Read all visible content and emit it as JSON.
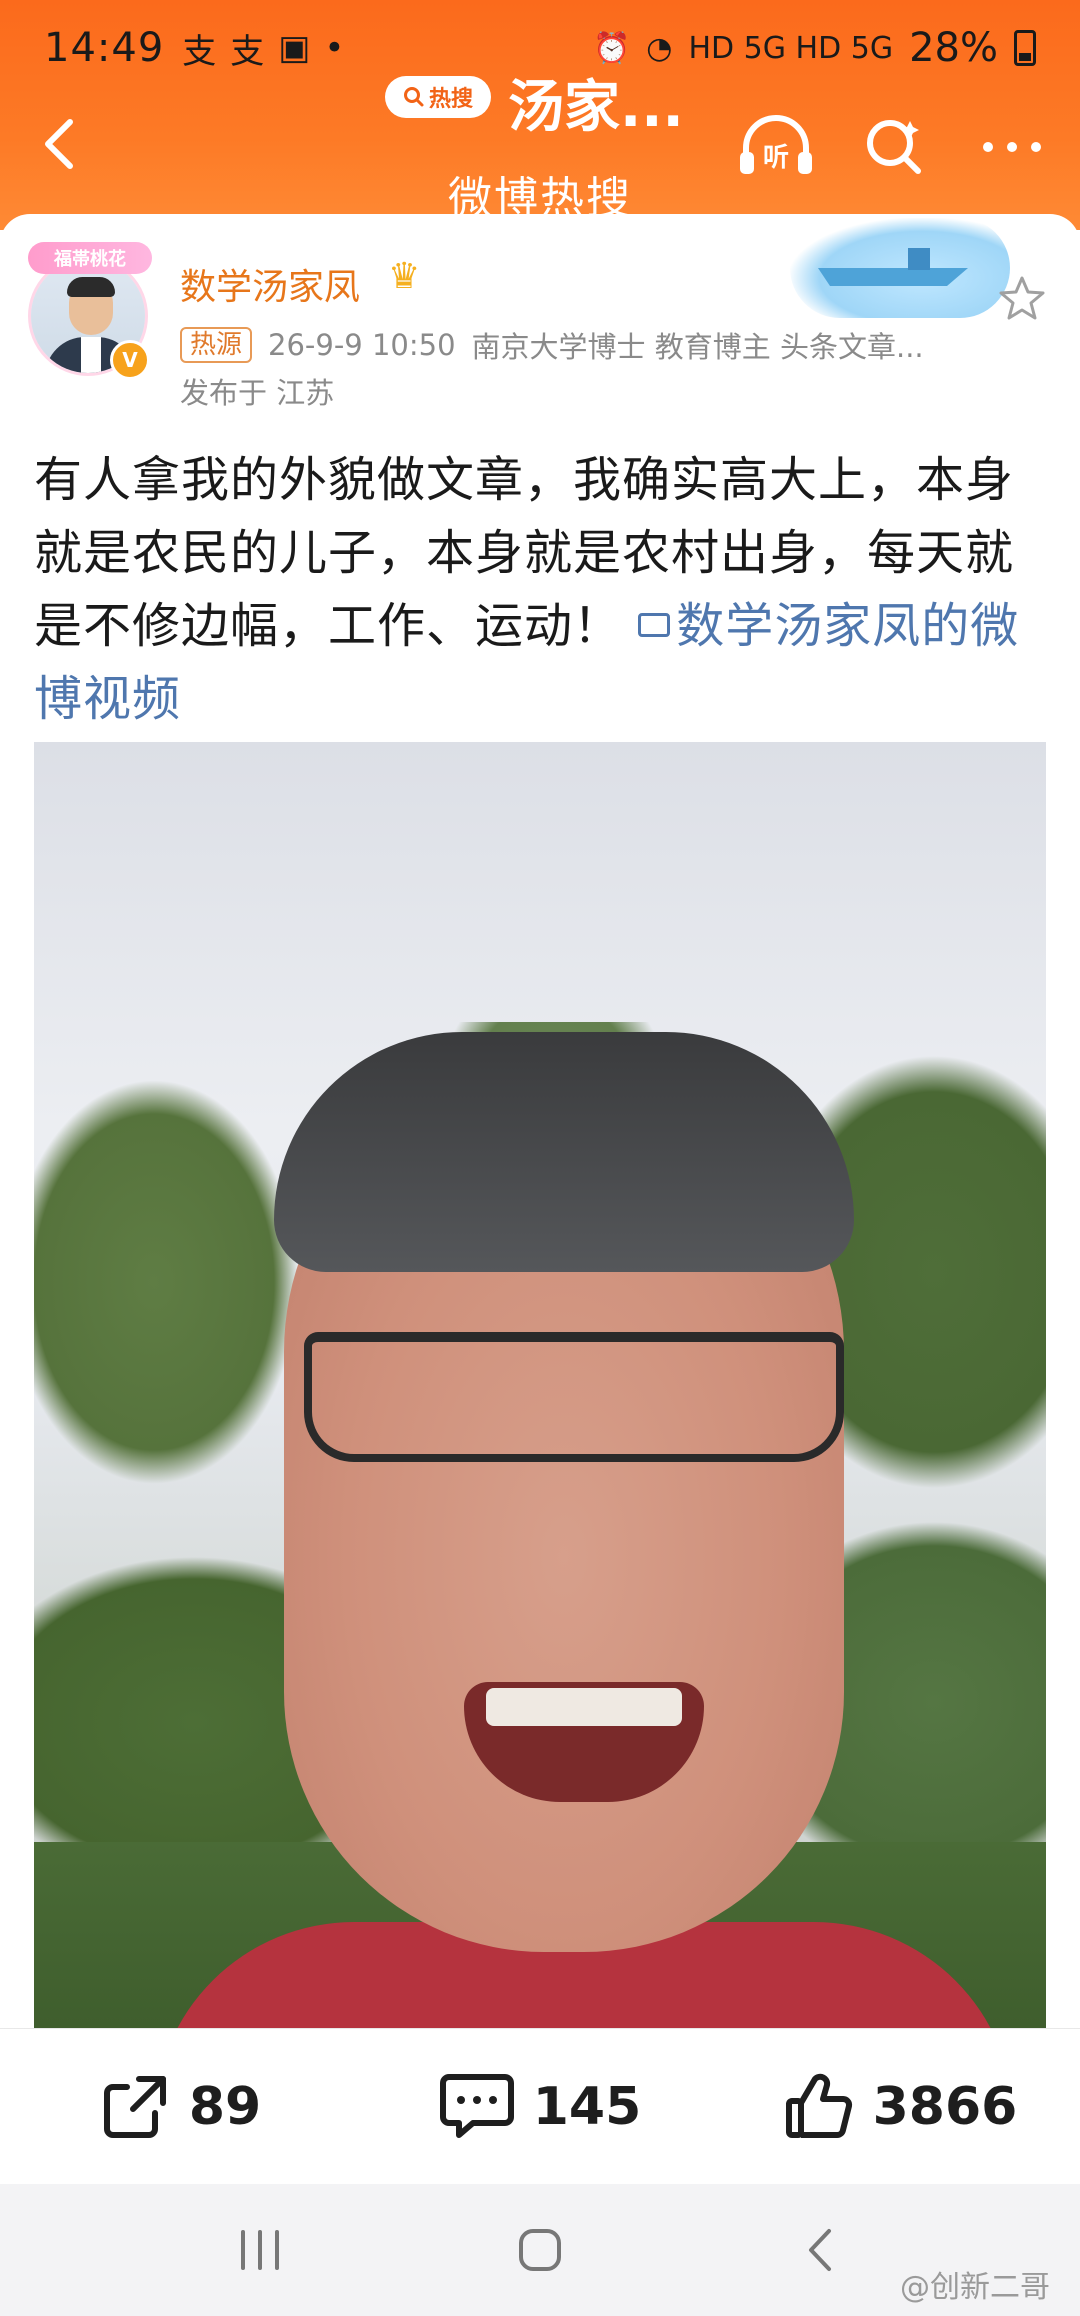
{
  "status_bar": {
    "time": "14:49",
    "left_icons": [
      "alipay-icon",
      "alipay-icon",
      "gallery-icon",
      "dot-icon"
    ],
    "network": "HD 5G HD 5G",
    "battery": "28%"
  },
  "nav": {
    "hot_badge": "热搜",
    "title": "汤家...",
    "subtitle": "微博热搜",
    "icons": [
      "listen-icon",
      "search-icon",
      "more-icon"
    ],
    "listen_label": "听"
  },
  "post": {
    "avatar_deco_text": "福帯桃花",
    "user_name": "数学汤家凤",
    "hot_tag": "热源",
    "timestamp": "26-9-9 10:50",
    "bio": "南京大学博士 教育博主 头条文章...",
    "location": "发布于 江苏",
    "text": "有人拿我的外貌做文章，我确实高大上，本身就是农民的儿子，本身就是农村出身，每天就是不修边幅，工作、运动！",
    "video_link": "数学汤家凤的微博视频"
  },
  "actions": {
    "repost_count": "89",
    "comment_count": "145",
    "like_count": "3866"
  },
  "watermark": "@创新二哥",
  "colors": {
    "header_orange": "#fb6a1c",
    "username_orange": "#e7761a",
    "link_blue": "#4f77ae"
  }
}
